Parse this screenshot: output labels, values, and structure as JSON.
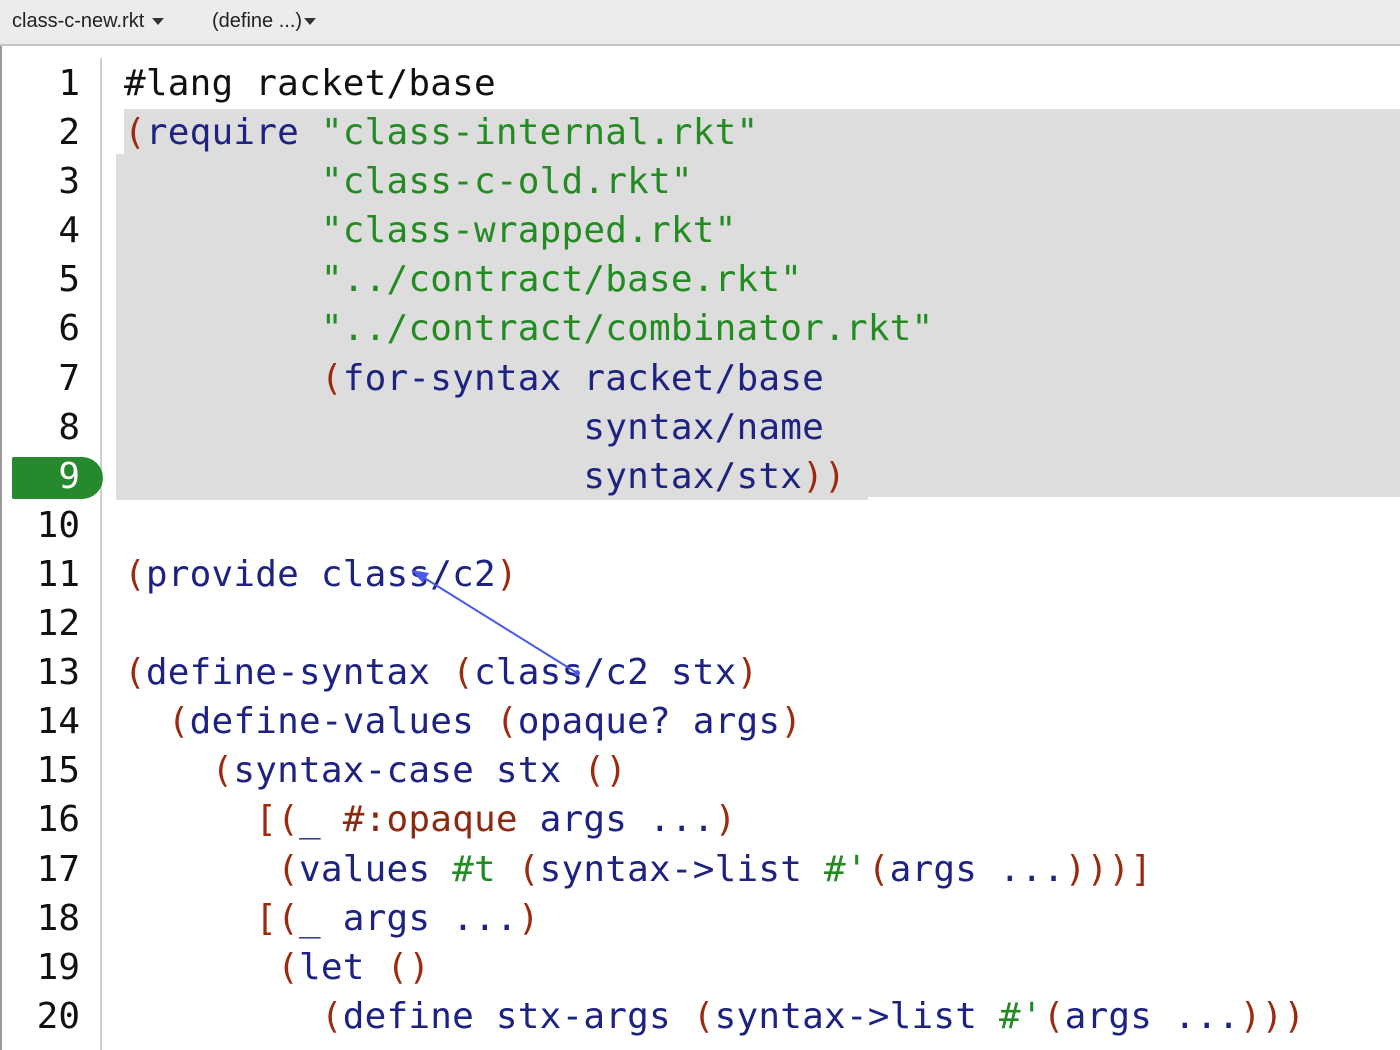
{
  "toolbar": {
    "file_menu": "class-c-new.rkt",
    "define_menu": "(define ...)"
  },
  "editor": {
    "current_line": 9,
    "colors": {
      "paren": "#9b2a10",
      "symbol": "#1e2280",
      "string": "#238b22",
      "constant": "#228b22",
      "selection": "#dddddd",
      "current_line_badge": "#27892e",
      "arrow": "#4a5ae8"
    },
    "lines": [
      {
        "n": "1",
        "tokens": [
          [
            "plain",
            "#lang racket/base"
          ]
        ]
      },
      {
        "n": "2",
        "tokens": [
          [
            "paren",
            "("
          ],
          [
            "sym",
            "require"
          ],
          [
            "plain",
            " "
          ],
          [
            "str",
            "\"class-internal.rkt\""
          ]
        ]
      },
      {
        "n": "3",
        "tokens": [
          [
            "plain",
            "         "
          ],
          [
            "str",
            "\"class-c-old.rkt\""
          ]
        ]
      },
      {
        "n": "4",
        "tokens": [
          [
            "plain",
            "         "
          ],
          [
            "str",
            "\"class-wrapped.rkt\""
          ]
        ]
      },
      {
        "n": "5",
        "tokens": [
          [
            "plain",
            "         "
          ],
          [
            "str",
            "\"../contract/base.rkt\""
          ]
        ]
      },
      {
        "n": "6",
        "tokens": [
          [
            "plain",
            "         "
          ],
          [
            "str",
            "\"../contract/combinator.rkt\""
          ]
        ]
      },
      {
        "n": "7",
        "tokens": [
          [
            "plain",
            "         "
          ],
          [
            "paren",
            "("
          ],
          [
            "sym",
            "for-syntax racket/base"
          ]
        ]
      },
      {
        "n": "8",
        "tokens": [
          [
            "plain",
            "                     "
          ],
          [
            "sym",
            "syntax/name"
          ]
        ]
      },
      {
        "n": "9",
        "tokens": [
          [
            "plain",
            "                     "
          ],
          [
            "sym",
            "syntax/stx"
          ],
          [
            "paren",
            "))"
          ]
        ]
      },
      {
        "n": "10",
        "tokens": []
      },
      {
        "n": "11",
        "tokens": [
          [
            "paren",
            "("
          ],
          [
            "sym",
            "provide class/c2"
          ],
          [
            "paren",
            ")"
          ]
        ]
      },
      {
        "n": "12",
        "tokens": []
      },
      {
        "n": "13",
        "tokens": [
          [
            "paren",
            "("
          ],
          [
            "sym",
            "define-syntax"
          ],
          [
            "plain",
            " "
          ],
          [
            "paren",
            "("
          ],
          [
            "sym",
            "class/c2 stx"
          ],
          [
            "paren",
            ")"
          ]
        ]
      },
      {
        "n": "14",
        "tokens": [
          [
            "plain",
            "  "
          ],
          [
            "paren",
            "("
          ],
          [
            "sym",
            "define-values"
          ],
          [
            "plain",
            " "
          ],
          [
            "paren",
            "("
          ],
          [
            "sym",
            "opaque? args"
          ],
          [
            "paren",
            ")"
          ]
        ]
      },
      {
        "n": "15",
        "tokens": [
          [
            "plain",
            "    "
          ],
          [
            "paren",
            "("
          ],
          [
            "sym",
            "syntax-case stx"
          ],
          [
            "plain",
            " "
          ],
          [
            "paren",
            "()"
          ]
        ]
      },
      {
        "n": "16",
        "tokens": [
          [
            "plain",
            "      "
          ],
          [
            "paren",
            "[("
          ],
          [
            "sym",
            "_"
          ],
          [
            "plain",
            " "
          ],
          [
            "kw",
            "#:opaque"
          ],
          [
            "plain",
            " "
          ],
          [
            "sym",
            "args ..."
          ],
          [
            "paren",
            ")"
          ]
        ]
      },
      {
        "n": "17",
        "tokens": [
          [
            "plain",
            "       "
          ],
          [
            "paren",
            "("
          ],
          [
            "sym",
            "values"
          ],
          [
            "plain",
            " "
          ],
          [
            "const",
            "#t"
          ],
          [
            "plain",
            " "
          ],
          [
            "paren",
            "("
          ],
          [
            "sym",
            "syntax->list"
          ],
          [
            "plain",
            " "
          ],
          [
            "const",
            "#'"
          ],
          [
            "paren",
            "("
          ],
          [
            "sym",
            "args ..."
          ],
          [
            "paren",
            ")))]"
          ]
        ]
      },
      {
        "n": "18",
        "tokens": [
          [
            "plain",
            "      "
          ],
          [
            "paren",
            "[("
          ],
          [
            "sym",
            "_ args ..."
          ],
          [
            "paren",
            ")"
          ]
        ]
      },
      {
        "n": "19",
        "tokens": [
          [
            "plain",
            "       "
          ],
          [
            "paren",
            "("
          ],
          [
            "sym",
            "let"
          ],
          [
            "plain",
            " "
          ],
          [
            "paren",
            "()"
          ]
        ]
      },
      {
        "n": "20",
        "tokens": [
          [
            "plain",
            "         "
          ],
          [
            "paren",
            "("
          ],
          [
            "sym",
            "define stx-args"
          ],
          [
            "plain",
            " "
          ],
          [
            "paren",
            "("
          ],
          [
            "sym",
            "syntax->list"
          ],
          [
            "plain",
            " "
          ],
          [
            "const",
            "#'"
          ],
          [
            "paren",
            "("
          ],
          [
            "sym",
            "args ..."
          ],
          [
            "paren",
            ")))"
          ]
        ]
      }
    ]
  }
}
